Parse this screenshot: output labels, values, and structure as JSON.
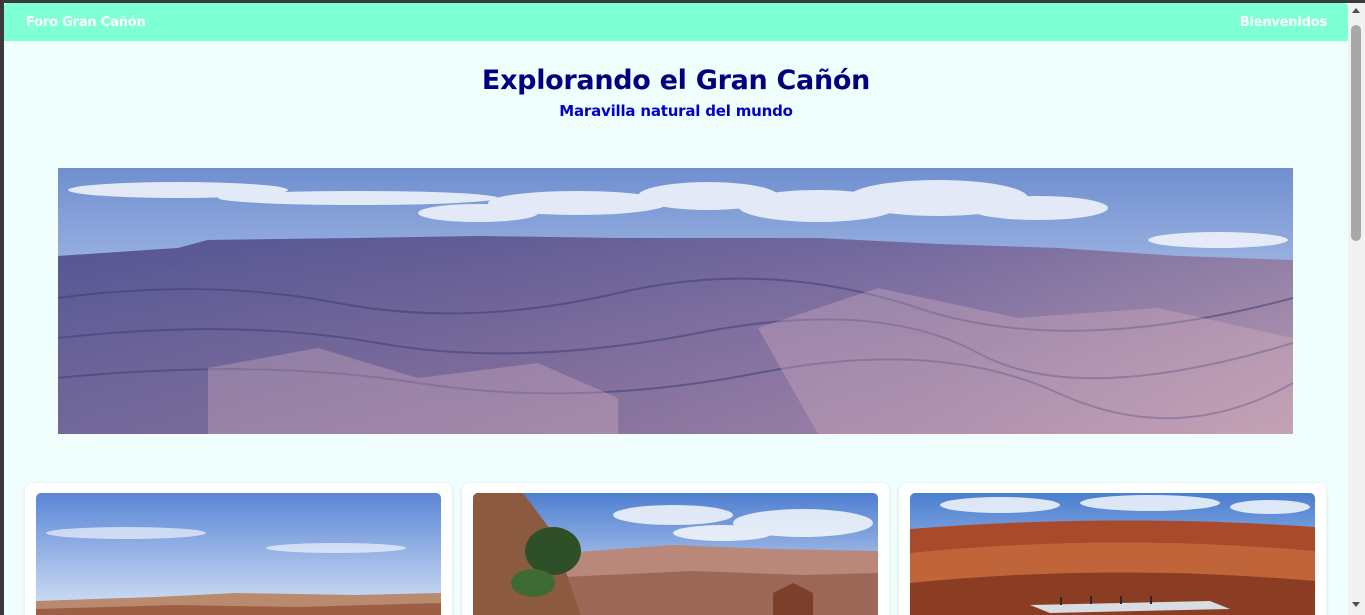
{
  "nav": {
    "brand": "Foro Gran Cañón",
    "welcome": "Bienvenidos"
  },
  "hero": {
    "title": "Explorando el Gran Cañón",
    "subtitle": "Maravilla natural del mundo"
  },
  "colors": {
    "navbar": "#7fffd4",
    "page_background": "#f0fffe",
    "title": "#000080",
    "subtitle": "#0000cd"
  },
  "images": {
    "banner": "grand-canyon-panorama-image",
    "cards": [
      "canyon-rim-view-image",
      "canyon-trail-view-image",
      "canyon-skywalk-view-image"
    ]
  }
}
